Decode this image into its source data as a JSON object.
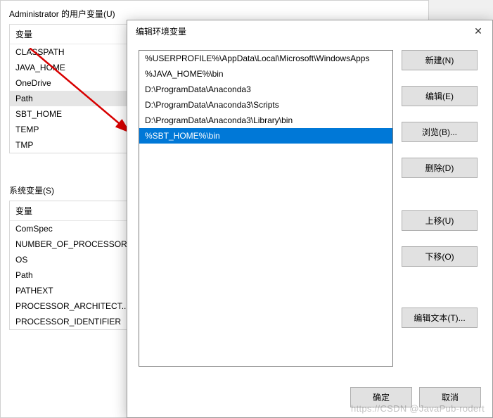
{
  "back": {
    "user_section_label": "Administrator 的用户变量(U)",
    "sys_section_label": "系统变量(S)",
    "var_header": "变量",
    "user_vars": [
      "CLASSPATH",
      "JAVA_HOME",
      "OneDrive",
      "Path",
      "SBT_HOME",
      "TEMP",
      "TMP"
    ],
    "user_selected_index": 3,
    "sys_vars": [
      "ComSpec",
      "NUMBER_OF_PROCESSORS",
      "OS",
      "Path",
      "PATHEXT",
      "PROCESSOR_ARCHITECT...",
      "PROCESSOR_IDENTIFIER"
    ]
  },
  "dialog": {
    "title": "编辑环境变量",
    "items": [
      "%USERPROFILE%\\AppData\\Local\\Microsoft\\WindowsApps",
      "%JAVA_HOME%\\bin",
      "D:\\ProgramData\\Anaconda3",
      "D:\\ProgramData\\Anaconda3\\Scripts",
      "D:\\ProgramData\\Anaconda3\\Library\\bin",
      "%SBT_HOME%\\bin"
    ],
    "selected_index": 5,
    "buttons": {
      "new": "新建(N)",
      "edit": "编辑(E)",
      "browse": "浏览(B)...",
      "delete": "删除(D)",
      "up": "上移(U)",
      "down": "下移(O)",
      "edit_text": "编辑文本(T)...",
      "ok": "确定",
      "cancel": "取消"
    }
  },
  "watermark": "https://CSDN @JavaPub-rodert"
}
